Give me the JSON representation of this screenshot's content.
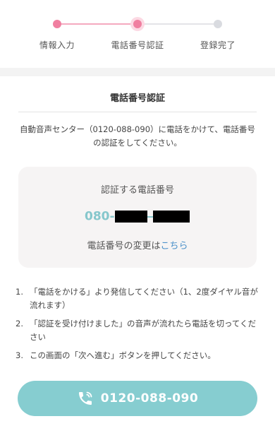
{
  "stepper": {
    "steps": [
      {
        "label": "情報入力",
        "state": "done"
      },
      {
        "label": "電話番号認証",
        "state": "active"
      },
      {
        "label": "登録完了",
        "state": "todo"
      }
    ],
    "colors": {
      "active": "#f07fa0",
      "inactive": "#d9dbe0"
    }
  },
  "main": {
    "title": "電話番号認証",
    "intro": "自動音声センター（0120-088-090）に電話をかけて、電話番号の認証をしてください。",
    "card": {
      "title": "認証する電話番号",
      "number_prefix": "080-",
      "change_text": "電話番号の変更は",
      "change_link": "こちら"
    },
    "instructions": [
      {
        "index": "1.",
        "text": "「電話をかける」より発信してください（1、2度ダイヤル音が流れます）"
      },
      {
        "index": "2.",
        "text": "「認証を受け付けました」の音声が流れたら電話を切ってください"
      },
      {
        "index": "3.",
        "text": "この画面の「次へ進む」ボタンを押してください。"
      }
    ],
    "call_button": {
      "label": "0120-088-090",
      "icon": "phone-icon",
      "color": "#86cdd0"
    }
  }
}
